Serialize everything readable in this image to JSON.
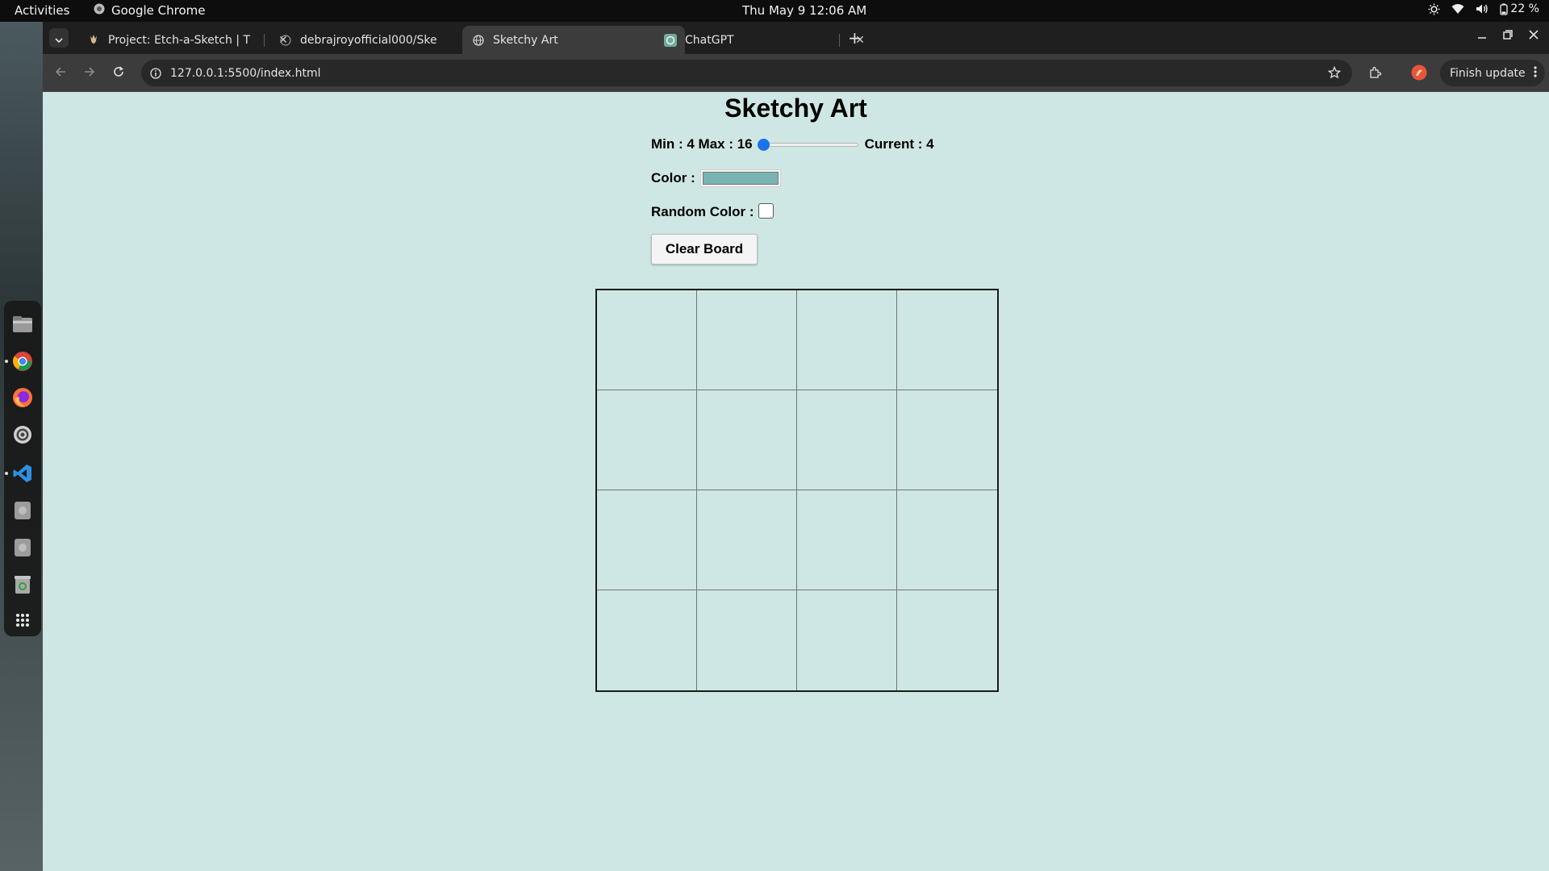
{
  "system": {
    "activities": "Activities",
    "app_name": "Google Chrome",
    "clock": "Thu May 9  12:06 AM",
    "battery": "22 %"
  },
  "browser": {
    "tabs": [
      {
        "title": "Project: Etch-a-Sketch | T",
        "icon": "odin-icon",
        "active": false
      },
      {
        "title": "debrajroyofficial000/Ske",
        "icon": "github-icon",
        "active": false
      },
      {
        "title": "Sketchy Art",
        "icon": "globe-icon",
        "active": true
      },
      {
        "title": "ChatGPT",
        "icon": "chatgpt-icon",
        "active": false
      }
    ],
    "url": "127.0.0.1:5500/index.html",
    "finish_update": "Finish update"
  },
  "app": {
    "title": "Sketchy Art",
    "size_label": "Min : 4 Max : 16",
    "slider": {
      "min": 4,
      "max": 16,
      "value": 4
    },
    "current_label": "Current : 4",
    "color_label": "Color :",
    "color_value": "#78b5b2",
    "random_label": "Random Color :",
    "random_checked": false,
    "clear_button": "Clear Board",
    "grid_size": 4
  }
}
